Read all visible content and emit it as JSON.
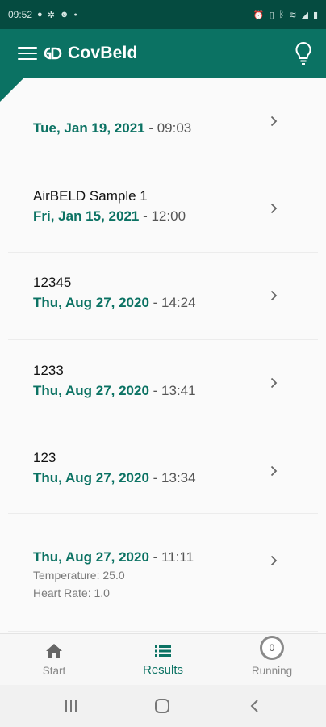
{
  "status_bar": {
    "time": "09:52",
    "left_icons": [
      "chat-icon",
      "star-icon",
      "smiley-icon",
      "dot-icon"
    ],
    "right_icons": [
      "alarm-icon",
      "vibrate-icon",
      "bluetooth-icon",
      "wifi-icon",
      "signal-icon",
      "battery-icon"
    ]
  },
  "app_bar": {
    "title": "CovBeld",
    "logo_text": "ɢɗ"
  },
  "colors": {
    "primary": "#0b7263",
    "status_bar": "#054b40",
    "date_text": "#0b7263",
    "time_text": "#555555",
    "nav_inactive": "#888888"
  },
  "results": [
    {
      "name": "",
      "date": "Tue, Jan 19, 2021",
      "time": " - 09:03",
      "extra": []
    },
    {
      "name": "AirBELD Sample 1",
      "date": "Fri, Jan 15, 2021",
      "time": " - 12:00",
      "extra": []
    },
    {
      "name": "12345",
      "date": "Thu, Aug 27, 2020",
      "time": " - 14:24",
      "extra": []
    },
    {
      "name": "1233",
      "date": "Thu, Aug 27, 2020",
      "time": " - 13:41",
      "extra": []
    },
    {
      "name": "123",
      "date": "Thu, Aug 27, 2020",
      "time": " - 13:34",
      "extra": []
    },
    {
      "name": "",
      "date": "Thu, Aug 27, 2020",
      "time": " - 11:11",
      "extra": [
        "Temperature: 25.0",
        "Heart Rate: 1.0"
      ]
    }
  ],
  "bottom_nav": {
    "start_label": "Start",
    "results_label": "Results",
    "running_label": "Running",
    "running_count": "0",
    "active": "results"
  }
}
